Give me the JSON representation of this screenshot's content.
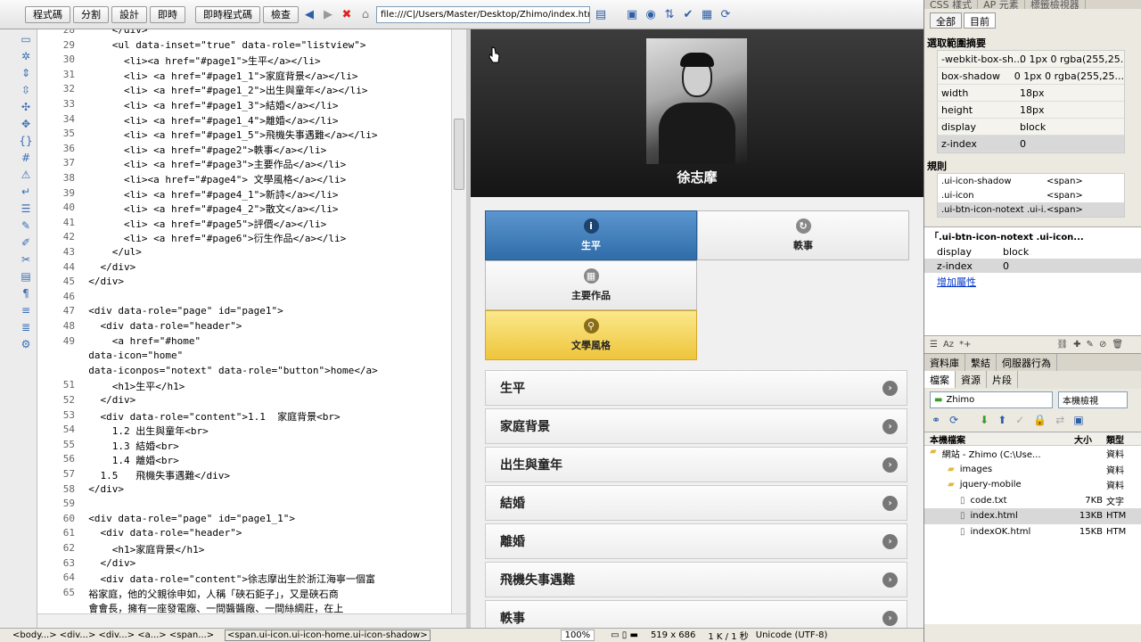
{
  "toolbar": {
    "buttons": [
      "程式碼",
      "分割",
      "設計",
      "即時"
    ],
    "live_code": "即時程式碼",
    "inspect": "檢查",
    "address": "file:///C|/Users/Master/Desktop/Zhimo/index.html"
  },
  "code": {
    "line_numbers": [
      "28",
      "29",
      "30",
      "31",
      "32",
      "33",
      "34",
      "35",
      "36",
      "37",
      "38",
      "39",
      "40",
      "41",
      "42",
      "43",
      "44",
      "45",
      "46",
      "47",
      "48",
      "49",
      "",
      "",
      "51",
      "52",
      "53",
      "54",
      "55",
      "56",
      "57",
      "58",
      "59",
      "60",
      "61",
      "62",
      "63",
      "64",
      "65",
      "",
      ""
    ],
    "lines": [
      "      </div>",
      "      <ul data-inset=\"true\" data-role=\"listview\">",
      "        <li><a href=\"#page1\">生平</a></li>",
      "        <li> <a href=\"#page1_1\">家庭背景</a></li>",
      "        <li> <a href=\"#page1_2\">出生與童年</a></li>",
      "        <li> <a href=\"#page1_3\">結婚</a></li>",
      "        <li> <a href=\"#page1_4\">離婚</a></li>",
      "        <li> <a href=\"#page1_5\">飛機失事遇難</a></li>",
      "        <li> <a href=\"#page2\">軼事</a></li>",
      "        <li> <a href=\"#page3\">主要作品</a></li>",
      "        <li><a href=\"#page4\"> 文學風格</a></li>",
      "        <li> <a href=\"#page4_1\">新詩</a></li>",
      "        <li> <a href=\"#page4_2\">散文</a></li>",
      "        <li> <a href=\"#page5\">評價</a></li>",
      "        <li> <a href=\"#page6\">衍生作品</a></li>",
      "      </ul>",
      "    </div>",
      "  </div>",
      "",
      "  <div data-role=\"page\" id=\"page1\">",
      "    <div data-role=\"header\">",
      "      <a href=\"#home\"",
      "  data-icon=\"home\"",
      "  data-iconpos=\"notext\" data-role=\"button\">home</a>",
      "      <h1>生平</h1>",
      "    </div>",
      "    <div data-role=\"content\">1.1  家庭背景<br>",
      "      1.2 出生與童年<br>",
      "      1.3 結婚<br>",
      "      1.4 離婚<br>",
      "    1.5   飛機失事遇難</div>",
      "  </div>",
      "",
      "  <div data-role=\"page\" id=\"page1_1\">",
      "    <div data-role=\"header\">",
      "      <h1>家庭背景</h1>",
      "    </div>",
      "    <div data-role=\"content\">徐志摩出生於浙江海寧一個富",
      "  裕家庭，他的父親徐申如，人稱「硤石鉅子」，又是硤石商",
      "  會會長，擁有一座發電廠、一間醬醬廠、一間絲綢莊，在上"
    ]
  },
  "preview": {
    "header_name": "徐志摩",
    "navbar": [
      {
        "label": "生平",
        "icon": "info-icon",
        "active": true
      },
      {
        "label": "軼事",
        "icon": "refresh-icon",
        "active": false
      },
      {
        "label": "主要作品",
        "icon": "grid-icon",
        "active": false
      },
      {
        "label": "文學風格",
        "icon": "search-icon",
        "highlight": true
      }
    ],
    "list": [
      "生平",
      "家庭背景",
      "出生與童年",
      "結婚",
      "離婚",
      "飛機失事遇難",
      "軼事"
    ]
  },
  "css_panel": {
    "tabs": [
      "CSS 樣式",
      "AP 元素",
      "標籤檢視器"
    ],
    "mode_tabs": [
      "全部",
      "目前"
    ],
    "summary_title": "選取範圍摘要",
    "summary": [
      {
        "prop": "-webkit-box-sh...",
        "val": "0 1px 0 rgba(255,25..."
      },
      {
        "prop": "box-shadow",
        "val": "0 1px 0 rgba(255,25..."
      },
      {
        "prop": "width",
        "val": "18px"
      },
      {
        "prop": "height",
        "val": "18px"
      },
      {
        "prop": "display",
        "val": "block"
      },
      {
        "prop": "z-index",
        "val": "0"
      }
    ],
    "rules_title": "規則",
    "rules": [
      {
        "name": ".ui-icon-shadow",
        "tag": "<span>"
      },
      {
        "name": ".ui-icon",
        "tag": "<span>"
      },
      {
        "name": ".ui-btn-icon-notext .ui-i...",
        "tag": "<span>"
      }
    ],
    "props_title": "「.ui-btn-icon-notext .ui-icon...",
    "props": [
      {
        "prop": "display",
        "val": "block"
      },
      {
        "prop": "z-index",
        "val": "0"
      }
    ],
    "add_prop": "增加屬性"
  },
  "files_panel": {
    "tabs": [
      "資料庫",
      "繫結",
      "伺服器行為"
    ],
    "subtabs": [
      "檔案",
      "資源",
      "片段"
    ],
    "site": "Zhimo",
    "view": "本機檢視",
    "headers": [
      "本機檔案",
      "大小",
      "類型"
    ],
    "rows": [
      {
        "name": "網站 - Zhimo (C:\\Use...",
        "size": "",
        "type": "資料"
      },
      {
        "name": "images",
        "size": "",
        "type": "資料"
      },
      {
        "name": "jquery-mobile",
        "size": "",
        "type": "資料"
      },
      {
        "name": "code.txt",
        "size": "7KB",
        "type": "文字"
      },
      {
        "name": "index.html",
        "size": "13KB",
        "type": "HTM"
      },
      {
        "name": "indexOK.html",
        "size": "15KB",
        "type": "HTM"
      }
    ]
  },
  "status": {
    "tags": "<body...> <div...> <div...> <a...> <span...>",
    "current_tag": "<span.ui-icon.ui-icon-home.ui-icon-shadow>",
    "zoom": "100%",
    "size": "519 x 686",
    "speed": "1 K / 1 秒",
    "encoding": "Unicode (UTF-8)"
  }
}
